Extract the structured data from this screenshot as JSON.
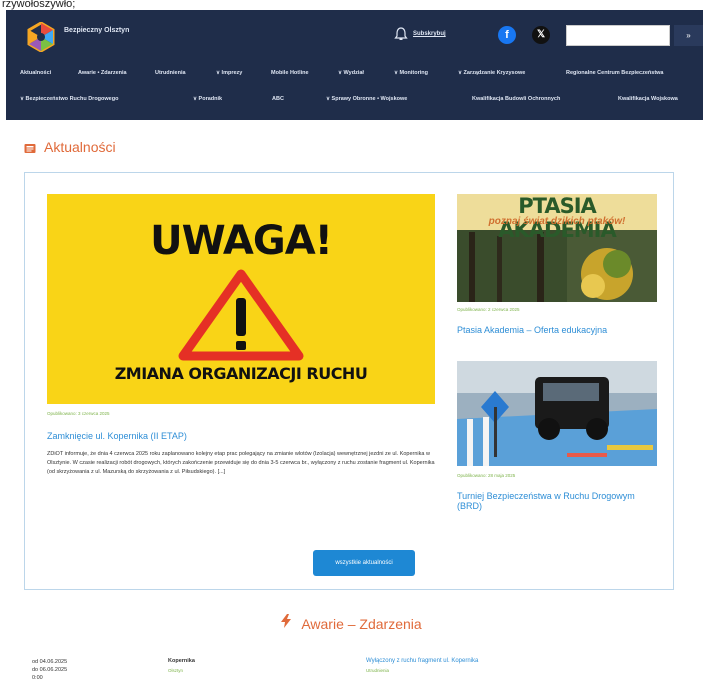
{
  "top_text": "rzywołoszywło;",
  "header": {
    "site_name": "Bezpieczny Olsztyn",
    "subscribe_label": "Subskrybuj",
    "search_button": "»",
    "facebook_glyph": "f",
    "x_glyph": "𝕏"
  },
  "nav": {
    "row1": [
      "Aktualności",
      "Awarie • Zdarzenia",
      "Utrudnienia",
      "∨ Imprezy",
      "Mobile Hotline",
      "∨ Wydział",
      "∨ Monitoring",
      "∨ Zarządzanie Kryzysowe",
      "Regionalne Centrum Bezpieczeństwa"
    ],
    "row2": [
      "∨ Bezpieczeństwo Ruchu Drogowego",
      "∨ Poradnik",
      "ABC",
      "∨ Sprawy Obronne • Wojskowe",
      "Kwalifikacja Budowli Ochronnych",
      "Kwalifikacja Wojskowa"
    ]
  },
  "news_section": {
    "title": "Aktualności",
    "main": {
      "image_heading": "UWAGA!",
      "image_subheading": "ZMIANA ORGANIZACJI RUCHU",
      "date": "Opublikowano: 3 czerwca 2025",
      "title": "Zamknięcie ul. Kopernika (II ETAP)",
      "excerpt": "ZDiOT informuje, że dnia 4 czerwca 2025 roku zaplanowano kolejny etap prac polegający na zmianie wlotów (Izolacja) wewnętrznej jezdni ze ul. Kopernika w Olsztynie. W czasie realizacji robót drogowych, których zakończenie przewiduje się do dnia 3-5 czerwca br., wyłączony z ruchu zostanie fragment ul. Kopernika (od skrzyżowania z ul. Mazurską do skrzyżowania z ul. Piłsudskiego). [...]"
    },
    "side": [
      {
        "image_heading": "PTASIA AKADEMIA",
        "image_subheading": "poznaj świat dzikich ptaków!",
        "date": "Opublikowano: 2 czerwca 2025",
        "title": "Ptasia Akademia – Oferta edukacyjna"
      },
      {
        "date": "Opublikowano: 28 maja 2025",
        "title": "Turniej Bezpieczeństwa w Ruchu Drogowym (BRD)"
      }
    ],
    "all_button": "wszystkie aktualności"
  },
  "events_section": {
    "title": "Awarie – Zdarzenia",
    "row": {
      "date_from": "od 04.06.2025",
      "date_to": "do 06.06.2025",
      "time": "0:00",
      "place": "Kopernika",
      "place_sub": "Olsztyn",
      "link": "Wyłączony z ruchu fragment ul. Kopernika",
      "link_sub": "Utrudnienia"
    }
  }
}
